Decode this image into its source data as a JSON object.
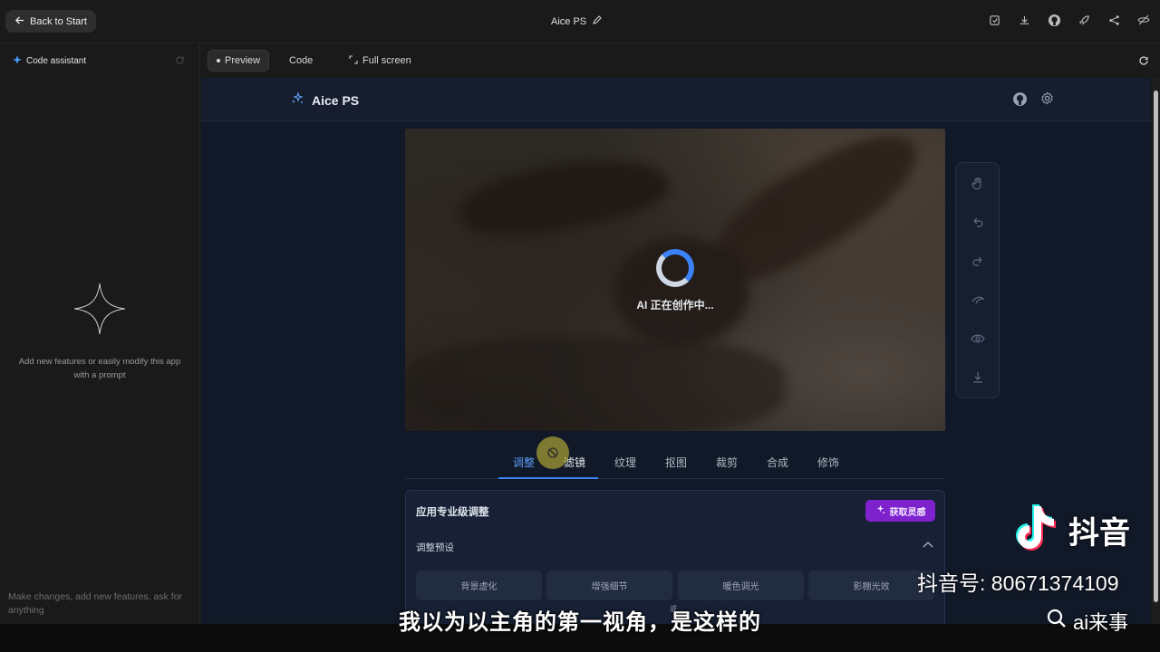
{
  "topbar": {
    "back_label": "Back to Start",
    "title": "Aice PS",
    "icons": [
      "save-icon",
      "download-icon",
      "github-icon",
      "rocket-icon",
      "share-icon",
      "hide-icon"
    ]
  },
  "sidebar": {
    "header": "Code assistant",
    "empty_text": "Add new features or easily modify this app with a prompt",
    "input_placeholder": "Make changes, add new features, ask for anything"
  },
  "preview_bar": {
    "tabs": [
      {
        "label": "Preview",
        "active": true
      },
      {
        "label": "Code",
        "active": false
      },
      {
        "label": "Full screen",
        "active": false
      }
    ]
  },
  "app": {
    "brand": "Aice PS",
    "header_icons": [
      "github-icon",
      "settings-icon"
    ],
    "loading_text": "AI 正在创作中...",
    "toolbar_icons": [
      "hand-icon",
      "undo-icon",
      "redo-icon",
      "compare-icon",
      "eye-icon",
      "download-icon"
    ],
    "tabs": [
      "调整",
      "滤镜",
      "纹理",
      "抠图",
      "裁剪",
      "合成",
      "修饰"
    ],
    "active_tab": "调整",
    "panel": {
      "title": "应用专业级调整",
      "inspire_button": "获取灵感",
      "preset_section": "调整预设",
      "presets": [
        "背景虚化",
        "增强细节",
        "暖色调光",
        "影棚光效"
      ],
      "partial_text": "或"
    }
  },
  "overlay": {
    "subtitle": "我以为以主角的第一视角，是这样的",
    "brand": "抖音",
    "account_id": "抖音号: 80671374109",
    "search_text": "ai来事"
  },
  "colors": {
    "accent_blue": "#3b82f6",
    "inspire_purple": "#7e22ce",
    "app_bg": "#111827"
  }
}
